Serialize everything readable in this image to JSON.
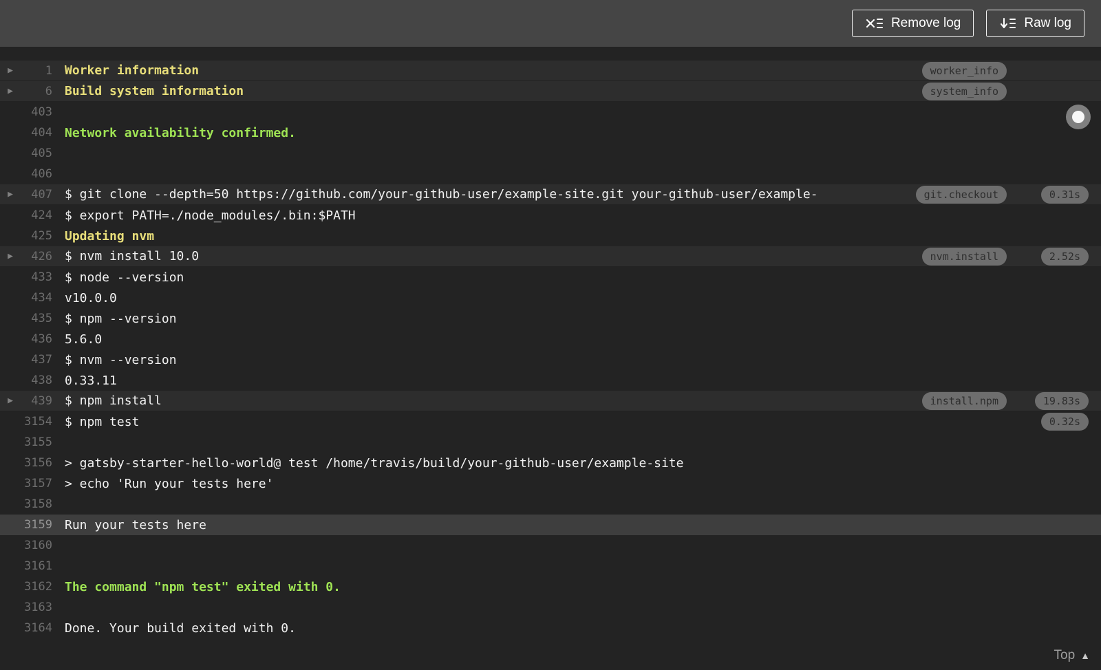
{
  "toolbar": {
    "remove_log_label": "Remove log",
    "raw_log_label": "Raw log"
  },
  "footer": {
    "top_label": "Top"
  },
  "colors": {
    "topbar_bg": "#454545",
    "log_bg": "#232323",
    "fold_header_bg": "#2d2d2d",
    "selected_row_bg": "#3e3e3e",
    "default_text": "#f1f1f1",
    "section_yellow": "#e8de7a",
    "success_green": "#9fe354",
    "line_number": "#6d6d6d",
    "pill_bg": "#6e6e6e",
    "pill_text": "#2e2e2e"
  },
  "log": {
    "rows": [
      {
        "line": "1",
        "text": "Worker information",
        "style": "section",
        "fold": true,
        "header": true,
        "tag": "worker_info",
        "time": null,
        "selected": false
      },
      {
        "line": "6",
        "text": "Build system information",
        "style": "section",
        "fold": true,
        "header": true,
        "tag": "system_info",
        "time": null,
        "selected": false
      },
      {
        "line": "403",
        "text": "",
        "style": "default",
        "fold": false,
        "header": false,
        "tag": null,
        "time": null,
        "selected": false
      },
      {
        "line": "404",
        "text": "Network availability confirmed.",
        "style": "success",
        "fold": false,
        "header": false,
        "tag": null,
        "time": null,
        "selected": false
      },
      {
        "line": "405",
        "text": "",
        "style": "default",
        "fold": false,
        "header": false,
        "tag": null,
        "time": null,
        "selected": false
      },
      {
        "line": "406",
        "text": "",
        "style": "default",
        "fold": false,
        "header": false,
        "tag": null,
        "time": null,
        "selected": false
      },
      {
        "line": "407",
        "text": "$ git clone --depth=50 https://github.com/your-github-user/example-site.git your-github-user/example-",
        "style": "default",
        "fold": true,
        "header": true,
        "tag": "git.checkout",
        "time": "0.31s",
        "selected": false
      },
      {
        "line": "424",
        "text": "$ export PATH=./node_modules/.bin:$PATH",
        "style": "default",
        "fold": false,
        "header": false,
        "tag": null,
        "time": null,
        "selected": false
      },
      {
        "line": "425",
        "text": "Updating nvm",
        "style": "section",
        "fold": false,
        "header": false,
        "tag": null,
        "time": null,
        "selected": false
      },
      {
        "line": "426",
        "text": "$ nvm install 10.0",
        "style": "default",
        "fold": true,
        "header": true,
        "tag": "nvm.install",
        "time": "2.52s",
        "selected": false
      },
      {
        "line": "433",
        "text": "$ node --version",
        "style": "default",
        "fold": false,
        "header": false,
        "tag": null,
        "time": null,
        "selected": false
      },
      {
        "line": "434",
        "text": "v10.0.0",
        "style": "default",
        "fold": false,
        "header": false,
        "tag": null,
        "time": null,
        "selected": false
      },
      {
        "line": "435",
        "text": "$ npm --version",
        "style": "default",
        "fold": false,
        "header": false,
        "tag": null,
        "time": null,
        "selected": false
      },
      {
        "line": "436",
        "text": "5.6.0",
        "style": "default",
        "fold": false,
        "header": false,
        "tag": null,
        "time": null,
        "selected": false
      },
      {
        "line": "437",
        "text": "$ nvm --version",
        "style": "default",
        "fold": false,
        "header": false,
        "tag": null,
        "time": null,
        "selected": false
      },
      {
        "line": "438",
        "text": "0.33.11",
        "style": "default",
        "fold": false,
        "header": false,
        "tag": null,
        "time": null,
        "selected": false
      },
      {
        "line": "439",
        "text": "$ npm install",
        "style": "default",
        "fold": true,
        "header": true,
        "tag": "install.npm",
        "time": "19.83s",
        "selected": false
      },
      {
        "line": "3154",
        "text": "$ npm test",
        "style": "default",
        "fold": false,
        "header": false,
        "tag": null,
        "time": "0.32s",
        "selected": false
      },
      {
        "line": "3155",
        "text": "",
        "style": "default",
        "fold": false,
        "header": false,
        "tag": null,
        "time": null,
        "selected": false
      },
      {
        "line": "3156",
        "text": "> gatsby-starter-hello-world@ test /home/travis/build/your-github-user/example-site",
        "style": "default",
        "fold": false,
        "header": false,
        "tag": null,
        "time": null,
        "selected": false
      },
      {
        "line": "3157",
        "text": "> echo 'Run your tests here'",
        "style": "default",
        "fold": false,
        "header": false,
        "tag": null,
        "time": null,
        "selected": false
      },
      {
        "line": "3158",
        "text": "",
        "style": "default",
        "fold": false,
        "header": false,
        "tag": null,
        "time": null,
        "selected": false
      },
      {
        "line": "3159",
        "text": "Run your tests here",
        "style": "default",
        "fold": false,
        "header": false,
        "tag": null,
        "time": null,
        "selected": true
      },
      {
        "line": "3160",
        "text": "",
        "style": "default",
        "fold": false,
        "header": false,
        "tag": null,
        "time": null,
        "selected": false
      },
      {
        "line": "3161",
        "text": "",
        "style": "default",
        "fold": false,
        "header": false,
        "tag": null,
        "time": null,
        "selected": false
      },
      {
        "line": "3162",
        "text": "The command \"npm test\" exited with 0.",
        "style": "success",
        "fold": false,
        "header": false,
        "tag": null,
        "time": null,
        "selected": false
      },
      {
        "line": "3163",
        "text": "",
        "style": "default",
        "fold": false,
        "header": false,
        "tag": null,
        "time": null,
        "selected": false
      },
      {
        "line": "3164",
        "text": "Done. Your build exited with 0.",
        "style": "default",
        "fold": false,
        "header": false,
        "tag": null,
        "time": null,
        "selected": false
      }
    ]
  }
}
